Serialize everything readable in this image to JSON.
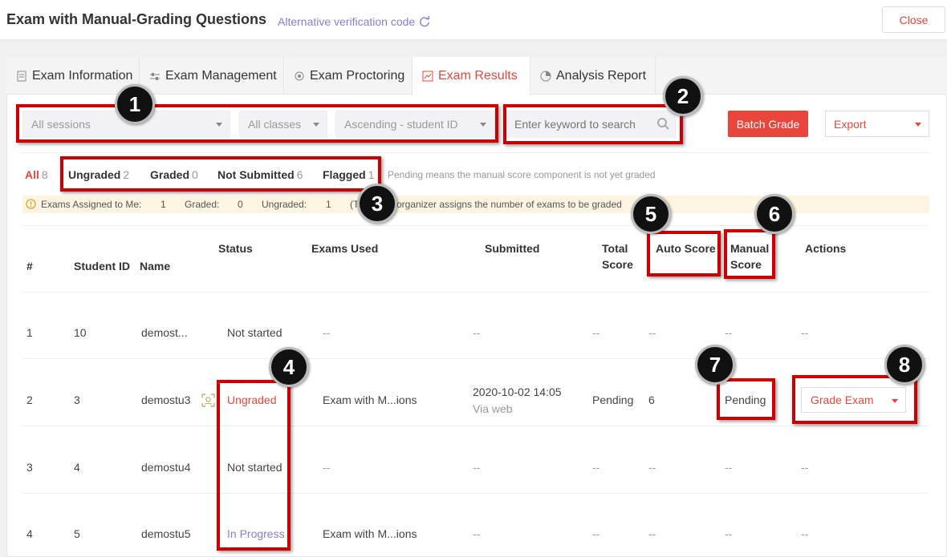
{
  "header": {
    "title": "Exam with Manual-Grading Questions",
    "alt_code": "Alternative verification code",
    "close_label": "Close"
  },
  "tabs": [
    {
      "label": "Exam Information",
      "icon": "document-icon"
    },
    {
      "label": "Exam Management",
      "icon": "sliders-icon"
    },
    {
      "label": "Exam Proctoring",
      "icon": "eye-icon"
    },
    {
      "label": "Exam Results",
      "icon": "chart-icon",
      "active": true
    },
    {
      "label": "Analysis Report",
      "icon": "pie-icon"
    }
  ],
  "filters": {
    "session": "All sessions",
    "class": "All classes",
    "sort": "Ascending - student ID",
    "search_placeholder": "Enter keyword to search",
    "batch_grade": "Batch Grade",
    "export": "Export"
  },
  "status_filters": [
    {
      "label": "All",
      "count": "8"
    },
    {
      "label": "Ungraded",
      "count": "2"
    },
    {
      "label": "Graded",
      "count": "0"
    },
    {
      "label": "Not Submitted",
      "count": "6"
    },
    {
      "label": "Flagged",
      "count": "1"
    }
  ],
  "status_note": "Pending means the manual score component is not yet graded",
  "banner": {
    "label": "Exams Assigned to Me:",
    "assigned": "1",
    "graded_label": "Graded:",
    "graded": "0",
    "ungraded_label": "Ungraded:",
    "ungraded": "1",
    "tip_prefix": "(T",
    "tip": "organizer assigns the number of exams to be graded"
  },
  "columns": {
    "num": "#",
    "student_id": "Student ID",
    "name": "Name",
    "status": "Status",
    "exams_used": "Exams Used",
    "submitted": "Submitted",
    "total_1": "Total",
    "total_2": "Score",
    "auto": "Auto Score",
    "manual_1": "Manual",
    "manual_2": "Score",
    "actions": "Actions"
  },
  "rows": [
    {
      "num": "1",
      "id": "10",
      "name": "demost...",
      "status": "Not started",
      "exam": "--",
      "submitted": "--",
      "via": "",
      "total": "--",
      "auto": "--",
      "manual": "--",
      "action": "--"
    },
    {
      "num": "2",
      "id": "3",
      "name": "demostu3",
      "status": "Ungraded",
      "exam": "Exam with M...ions",
      "submitted": "2020-10-02 14:05",
      "via": "Via web",
      "total": "Pending",
      "auto": "6",
      "manual": "Pending",
      "action": "Grade Exam"
    },
    {
      "num": "3",
      "id": "4",
      "name": "demostu4",
      "status": "Not started",
      "exam": "--",
      "submitted": "--",
      "via": "",
      "total": "--",
      "auto": "--",
      "manual": "--",
      "action": "--"
    },
    {
      "num": "4",
      "id": "5",
      "name": "demostu5",
      "status": "In Progress",
      "exam": "Exam with M...ions",
      "submitted": "--",
      "via": "",
      "total": "--",
      "auto": "--",
      "manual": "--",
      "action": "--"
    }
  ],
  "callouts": [
    "1",
    "2",
    "3",
    "4",
    "5",
    "6",
    "7",
    "8"
  ],
  "colors": {
    "accent": "#e8453c",
    "link": "#8a7bd9",
    "annotation": "#cc0000"
  }
}
